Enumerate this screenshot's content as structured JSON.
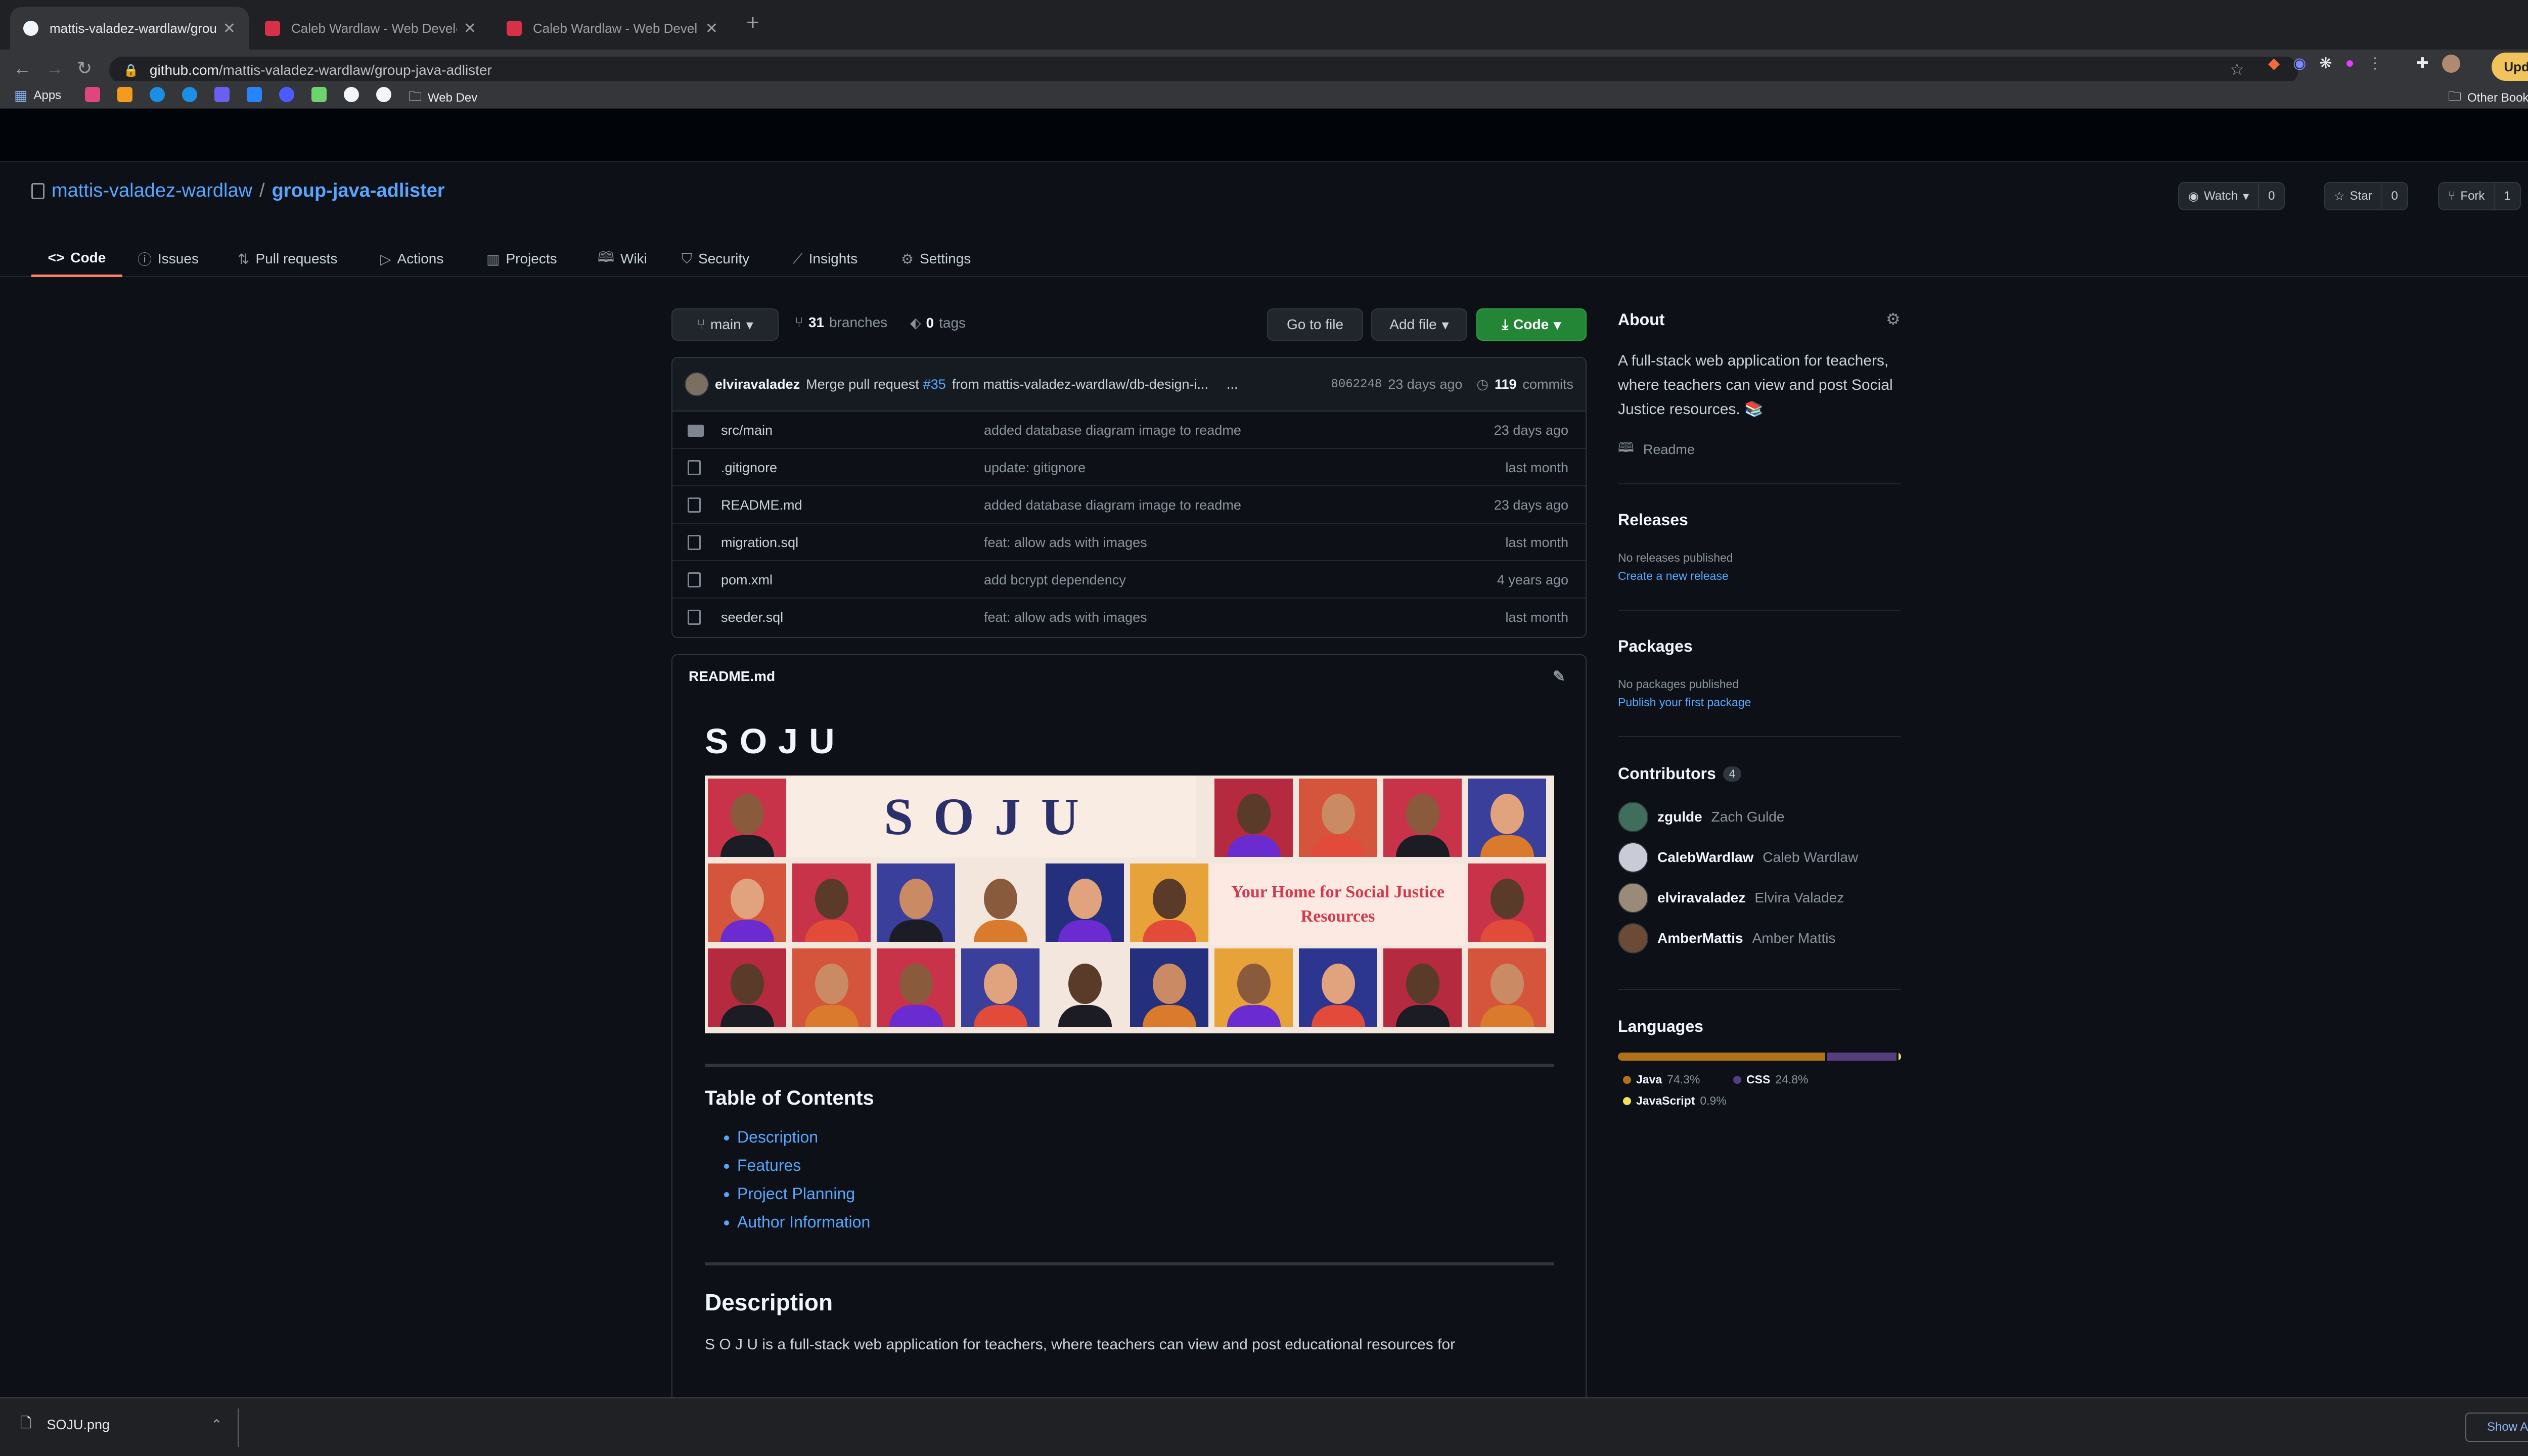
{
  "browser": {
    "tabs": [
      {
        "title": "mattis-valadez-wardlaw/group",
        "active": true
      },
      {
        "title": "Caleb Wardlaw - Web Develop",
        "active": false
      },
      {
        "title": "Caleb Wardlaw - Web Develop",
        "active": false
      }
    ],
    "new_tab": "+",
    "url_host": "github.com",
    "url_path": "/mattis-valadez-wardlaw/group-java-adlister",
    "update_label": "Update",
    "bookmarks": {
      "apps": "Apps",
      "webdev": "Web Dev",
      "other": "Other Bookmarks"
    }
  },
  "repo": {
    "owner": "mattis-valadez-wardlaw",
    "separator": "/",
    "name": "group-java-adlister",
    "watch_label": "Watch",
    "watch_count": "0",
    "star_label": "Star",
    "star_count": "0",
    "fork_label": "Fork",
    "fork_count": "1"
  },
  "nav": {
    "code": "Code",
    "issues": "Issues",
    "pulls": "Pull requests",
    "actions": "Actions",
    "projects": "Projects",
    "wiki": "Wiki",
    "security": "Security",
    "insights": "Insights",
    "settings": "Settings"
  },
  "toolbar": {
    "branch": "main",
    "branches_count": "31",
    "branches_label": "branches",
    "tags_count": "0",
    "tags_label": "tags",
    "goto_file": "Go to file",
    "add_file": "Add file",
    "code": "Code"
  },
  "commit": {
    "author": "elviravaladez",
    "msg_prefix": "Merge pull request",
    "pr": "#35",
    "msg_suffix": "from mattis-valadez-wardlaw/db-design-i...",
    "more": "...",
    "sha": "8062248",
    "age": "23 days ago",
    "commits_count": "119",
    "commits_label": "commits"
  },
  "files": [
    {
      "name": "src/main",
      "type": "dir",
      "message": "added database diagram image to readme",
      "age": "23 days ago"
    },
    {
      "name": ".gitignore",
      "type": "file",
      "message": "update: gitignore",
      "age": "last month"
    },
    {
      "name": "README.md",
      "type": "file",
      "message": "added database diagram image to readme",
      "age": "23 days ago"
    },
    {
      "name": "migration.sql",
      "type": "file",
      "message": "feat: allow ads with images",
      "age": "last month"
    },
    {
      "name": "pom.xml",
      "type": "file",
      "message": "add bcrypt dependency",
      "age": "4 years ago"
    },
    {
      "name": "seeder.sql",
      "type": "file",
      "message": "feat: allow ads with images",
      "age": "last month"
    }
  ],
  "readme": {
    "filename": "README.md",
    "title": "SOJU",
    "banner_title": "SOJU",
    "banner_tagline": "Your Home for Social Justice Resources",
    "toc_heading": "Table of Contents",
    "toc": [
      "Description",
      "Features",
      "Project Planning",
      "Author Information"
    ],
    "desc_heading": "Description",
    "desc_text": "S O J U is a full-stack web application for teachers, where teachers can view and post educational resources for"
  },
  "about": {
    "heading": "About",
    "text": "A full-stack web application for teachers, where teachers can view and post Social Justice resources. 📚",
    "readme_link": "Readme"
  },
  "releases": {
    "heading": "Releases",
    "none": "No releases published",
    "create": "Create a new release"
  },
  "packages": {
    "heading": "Packages",
    "none": "No packages published",
    "publish": "Publish your first package"
  },
  "contributors": {
    "heading": "Contributors",
    "count": "4",
    "list": [
      {
        "login": "zgulde",
        "name": "Zach Gulde",
        "color": "#3f6e5c"
      },
      {
        "login": "CalebWardlaw",
        "name": "Caleb Wardlaw",
        "color": "#c9ccd6"
      },
      {
        "login": "elviravaladez",
        "name": "Elvira Valadez",
        "color": "#9a8a78"
      },
      {
        "login": "AmberMattis",
        "name": "Amber Mattis",
        "color": "#6b4a36"
      }
    ]
  },
  "languages": {
    "heading": "Languages",
    "list": [
      {
        "name": "Java",
        "percent": "74.3%",
        "value": 74.3,
        "color": "#b07219"
      },
      {
        "name": "CSS",
        "percent": "24.8%",
        "value": 24.8,
        "color": "#563d7c"
      },
      {
        "name": "JavaScript",
        "percent": "0.9%",
        "value": 0.9,
        "color": "#f1e05a"
      }
    ]
  },
  "downloads": {
    "file": "SOJU.png",
    "show_all": "Show All",
    "close": "✕"
  }
}
